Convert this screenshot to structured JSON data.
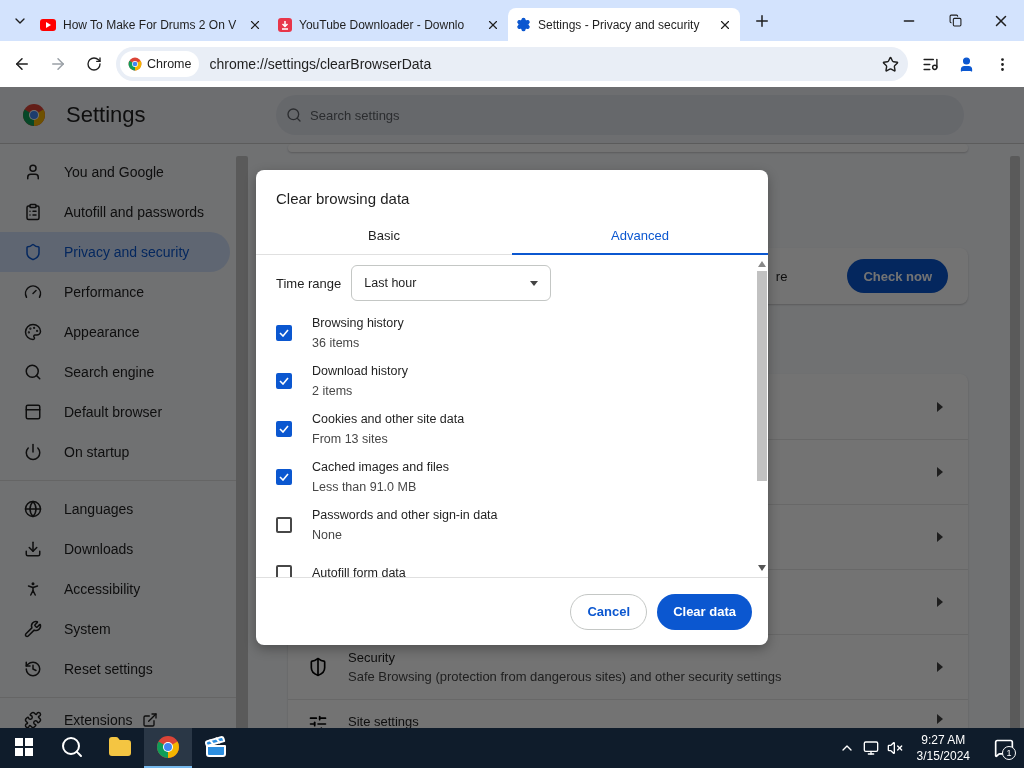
{
  "browser": {
    "tabs": [
      {
        "title": "How To Make For Drums 2 On V",
        "kind": "video",
        "selected": false
      },
      {
        "title": "YouTube Downloader - Downlo",
        "kind": "download",
        "selected": false
      },
      {
        "title": "Settings - Privacy and security",
        "kind": "settings",
        "selected": true
      }
    ],
    "omnibox": {
      "chip": "Chrome",
      "url": "chrome://settings/clearBrowserData"
    }
  },
  "settings": {
    "title": "Settings",
    "search": {
      "placeholder": "Search settings"
    },
    "sidebar": {
      "groups": [
        {
          "items": [
            {
              "label": "You and Google",
              "kind": "person",
              "selected": false
            },
            {
              "label": "Autofill and passwords",
              "kind": "clipboard",
              "selected": false
            },
            {
              "label": "Privacy and security",
              "kind": "shield",
              "selected": true
            },
            {
              "label": "Performance",
              "kind": "gauge",
              "selected": false
            },
            {
              "label": "Appearance",
              "kind": "palette",
              "selected": false
            },
            {
              "label": "Search engine",
              "kind": "search",
              "selected": false
            },
            {
              "label": "Default browser",
              "kind": "browser",
              "selected": false
            },
            {
              "label": "On startup",
              "kind": "power",
              "selected": false
            }
          ]
        },
        {
          "items": [
            {
              "label": "Languages",
              "kind": "globe",
              "selected": false
            },
            {
              "label": "Downloads",
              "kind": "download",
              "selected": false
            },
            {
              "label": "Accessibility",
              "kind": "accessibility",
              "selected": false
            },
            {
              "label": "System",
              "kind": "wrench",
              "selected": false
            },
            {
              "label": "Reset settings",
              "kind": "history",
              "selected": false
            }
          ]
        },
        {
          "items": [
            {
              "label": "Extensions",
              "kind": "puzzle",
              "external": true,
              "selected": false
            }
          ]
        }
      ]
    },
    "content": {
      "safety_check": {
        "fragment": "re",
        "button": "Check now"
      },
      "rows": [
        {
          "title": "Security",
          "subtitle": "Safe Browsing (protection from dangerous sites) and other security settings",
          "kind": "shield"
        },
        {
          "title": "Site settings",
          "kind": "sliders"
        }
      ]
    }
  },
  "dialog": {
    "title": "Clear browsing data",
    "tabs": [
      {
        "label": "Basic",
        "selected": false
      },
      {
        "label": "Advanced",
        "selected": true
      }
    ],
    "time_range": {
      "label": "Time range",
      "value": "Last hour"
    },
    "options": [
      {
        "label": "Browsing history",
        "detail": "36 items",
        "checked": true
      },
      {
        "label": "Download history",
        "detail": "2 items",
        "checked": true
      },
      {
        "label": "Cookies and other site data",
        "detail": "From 13 sites",
        "checked": true
      },
      {
        "label": "Cached images and files",
        "detail": "Less than 91.0 MB",
        "checked": true
      },
      {
        "label": "Passwords and other sign-in data",
        "detail": "None",
        "checked": false
      },
      {
        "label": "Autofill form data",
        "checked": false
      }
    ],
    "buttons": {
      "cancel": "Cancel",
      "confirm": "Clear data"
    }
  },
  "taskbar": {
    "apps": [
      {
        "kind": "search",
        "active": false
      },
      {
        "kind": "folder",
        "active": false
      },
      {
        "kind": "chrome",
        "active": true
      },
      {
        "kind": "editor",
        "active": false
      }
    ],
    "clock": {
      "time": "9:27 AM",
      "date": "3/15/2024"
    },
    "notifications": "1"
  }
}
